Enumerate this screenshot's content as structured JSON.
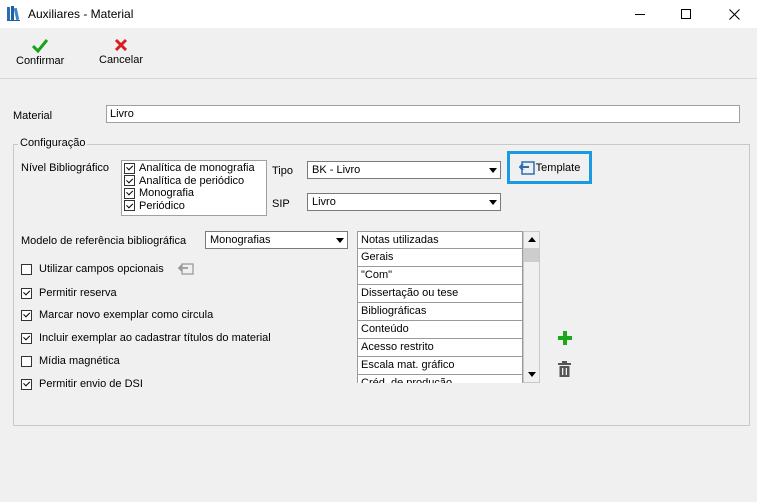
{
  "window": {
    "title": "Auxiliares - Material"
  },
  "toolbar": {
    "confirm_label": "Confirmar",
    "cancel_label": "Cancelar"
  },
  "material": {
    "label": "Material",
    "value": "Livro"
  },
  "config": {
    "legend": "Configuração",
    "nivel_label": "Nível Bibliográfico",
    "nivel_items": [
      {
        "label": "Analítica de monografia",
        "checked": true
      },
      {
        "label": "Analítica de periódico",
        "checked": true
      },
      {
        "label": "Monografia",
        "checked": true
      },
      {
        "label": "Periódico",
        "checked": true
      }
    ],
    "tipo_label": "Tipo",
    "tipo_value": "BK - Livro",
    "sip_label": "SIP",
    "sip_value": "Livro",
    "template_label": "Template",
    "modelo_label": "Modelo de referência bibliográfica",
    "modelo_value": "Monografias",
    "options": [
      {
        "label": "Utilizar campos opcionais",
        "checked": false
      },
      {
        "label": "Permitir reserva",
        "checked": true
      },
      {
        "label": "Marcar novo exemplar como circula",
        "checked": true
      },
      {
        "label": "Incluir exemplar ao cadastrar títulos do material",
        "checked": true
      },
      {
        "label": "Mídia magnética",
        "checked": false
      },
      {
        "label": "Permitir envio de DSI",
        "checked": true
      }
    ],
    "notas": {
      "header": "Notas utilizadas",
      "items": [
        "Gerais",
        "\"Com\"",
        "Dissertação ou tese",
        "Bibliográficas",
        "Conteúdo",
        "Acesso restrito",
        "Escala mat. gráfico",
        "Créd. de produção"
      ]
    }
  },
  "colors": {
    "accent": "#1a9be0",
    "confirm": "#16a316",
    "cancel": "#d81e1e",
    "add": "#1aa81a"
  }
}
